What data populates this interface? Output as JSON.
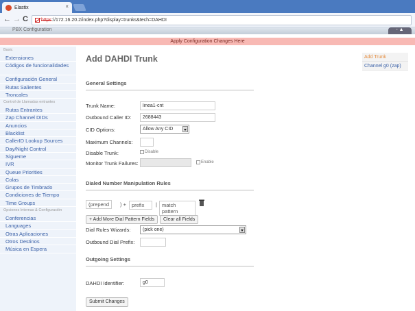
{
  "browser": {
    "tab_title": "Elastix",
    "tab_close": "×",
    "back": "←",
    "forward": "→",
    "reload": "C",
    "url_scheme": "https",
    "url_rest": "://172.16.20.2/index.php?display=trunks&tech=DAHDI"
  },
  "header": {
    "pbx_tab": "PBX Configuration",
    "apply_bar": "Apply Configuration Changes Here"
  },
  "sidebar": {
    "section_basic": "Basic",
    "items_basic": [
      "Extensiones",
      "Códigos de funcionalidades",
      "Configuración General",
      "Rutas Salientes",
      "Troncales"
    ],
    "section_inbound": "Control de Llamadas entrantes",
    "items_inbound": [
      "Rutas Entrantes",
      "Zap Channel DIDs",
      "Anuncios",
      "Blacklist",
      "CallerID Lookup Sources",
      "Day/Night Control",
      "Sígueme",
      "IVR",
      "Queue Priorities",
      "Colas",
      "Grupos de Timbrado",
      "Condiciones de Tiempo",
      "Time Groups"
    ],
    "section_internal": "Opciones Internas & Configuración",
    "items_internal": [
      "Conferencias",
      "Languages",
      "Otras Aplicaciones",
      "Otros Destinos",
      "Música en Espera"
    ]
  },
  "main": {
    "title": "Add DAHDI Trunk",
    "general_settings": "General Settings",
    "trunk_name_label": "Trunk Name:",
    "trunk_name_value": "linea1-cnt",
    "outbound_cid_label": "Outbound Caller ID:",
    "outbound_cid_value": "2688443",
    "cid_options_label": "CID Options:",
    "cid_options_value": "Allow Any CID",
    "max_channels_label": "Maximum Channels:",
    "max_channels_value": "",
    "disable_trunk_label": "Disable Trunk:",
    "disable_trunk_check": "Disable",
    "monitor_failures_label": "Monitor Trunk Failures:",
    "monitor_failures_check": "Enable",
    "dial_rules_section": "Dialed Number Manipulation Rules",
    "prepend_placeholder": "(prepend",
    "prefix_sep": ") +",
    "prefix_placeholder": "prefix",
    "match_sep": "|",
    "match_placeholder": "match pattern",
    "add_more_button": "+ Add More Dial Pattern Fields",
    "clear_all_button": "Clear all Fields",
    "dial_wizards_label": "Dial Rules Wizards:",
    "dial_wizards_value": "(pick one)",
    "outbound_prefix_label": "Outbound Dial Prefix:",
    "outgoing_section": "Outgoing Settings",
    "dahdi_id_label": "DAHDI Identifier:",
    "dahdi_id_value": "g0",
    "submit_button": "Submit Changes"
  },
  "right_panel": {
    "items": [
      "Add Trunk",
      "Channel g0 (zap)"
    ]
  }
}
